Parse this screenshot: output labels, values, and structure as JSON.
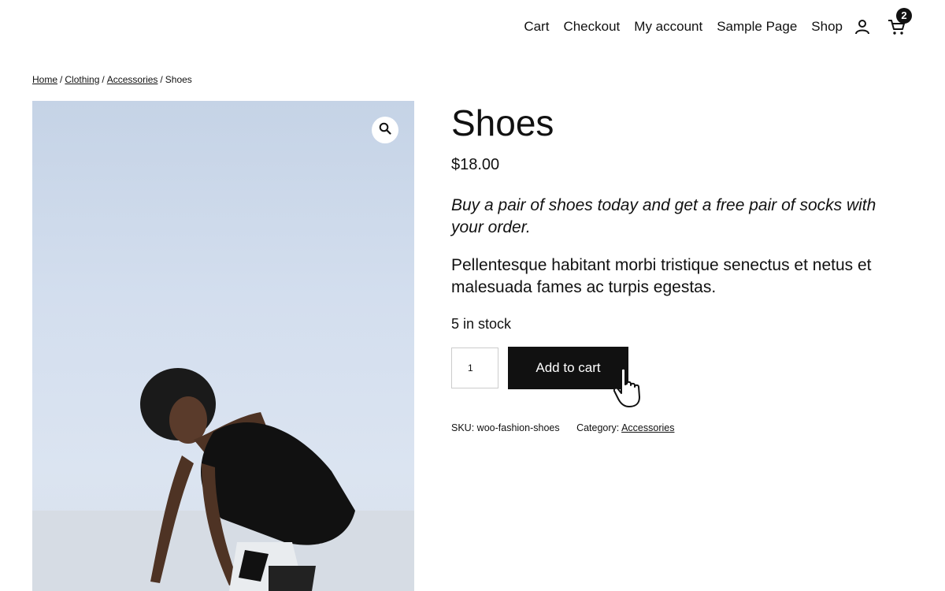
{
  "header": {
    "nav": [
      "Cart",
      "Checkout",
      "My account",
      "Sample Page",
      "Shop"
    ],
    "cart_count": "2",
    "icons": {
      "account": "user-icon",
      "cart": "cart-icon"
    }
  },
  "breadcrumb": {
    "items": [
      "Home",
      "Clothing",
      "Accessories"
    ],
    "current": "Shoes",
    "separator": "/"
  },
  "product": {
    "title": "Shoes",
    "price": "$18.00",
    "short_description": "Buy a pair of shoes today and get a free pair of socks with your order.",
    "description": "Pellentesque habitant morbi tristique senectus et netus et malesuada fames ac turpis egestas.",
    "stock": "5 in stock",
    "quantity": "1",
    "add_to_cart_label": "Add to cart",
    "sku_label": "SKU:",
    "sku": "woo-fashion-shoes",
    "category_label": "Category:",
    "category": "Accessories",
    "image_icon": "zoom-icon"
  },
  "colors": {
    "text": "#111111",
    "button_bg": "#111111",
    "button_text": "#ffffff",
    "image_bg": "#d3deee"
  }
}
